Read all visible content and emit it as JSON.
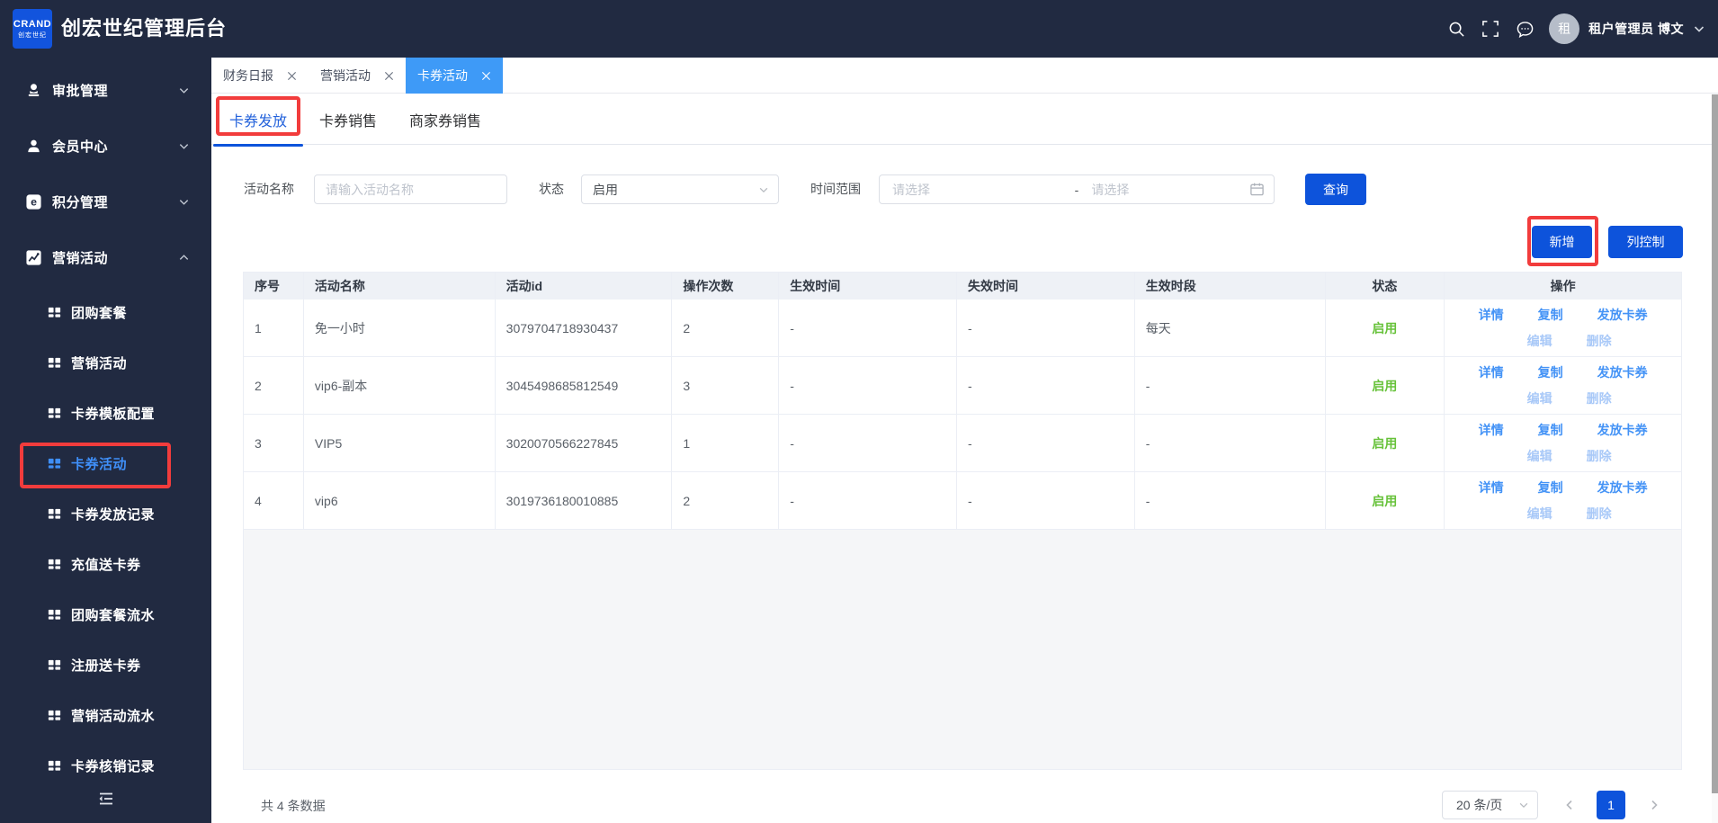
{
  "header": {
    "logo_line1": "CRAND",
    "logo_line2": "创宏世纪",
    "title": "创宏世纪管理后台",
    "user": {
      "avatar_text": "租",
      "name": "租户管理员 博文"
    }
  },
  "sidebar": {
    "menu": [
      {
        "label": "审批管理",
        "icon": "approval-user",
        "expanded": false
      },
      {
        "label": "会员中心",
        "icon": "member-user",
        "expanded": false
      },
      {
        "label": "积分管理",
        "icon": "points",
        "expanded": false
      },
      {
        "label": "营销活动",
        "icon": "marketing-chart",
        "expanded": true
      }
    ],
    "submenu": [
      {
        "label": "团购套餐",
        "active": false
      },
      {
        "label": "营销活动",
        "active": false
      },
      {
        "label": "卡券模板配置",
        "active": false
      },
      {
        "label": "卡券活动",
        "active": true
      },
      {
        "label": "卡券发放记录",
        "active": false
      },
      {
        "label": "充值送卡券",
        "active": false
      },
      {
        "label": "团购套餐流水",
        "active": false
      },
      {
        "label": "注册送卡券",
        "active": false
      },
      {
        "label": "营销活动流水",
        "active": false
      },
      {
        "label": "卡券核销记录",
        "active": false
      }
    ]
  },
  "tabs": [
    {
      "label": "财务日报",
      "active": false
    },
    {
      "label": "营销活动",
      "active": false
    },
    {
      "label": "卡券活动",
      "active": true
    }
  ],
  "subtabs": [
    {
      "label": "卡券发放",
      "active": true
    },
    {
      "label": "卡券销售",
      "active": false
    },
    {
      "label": "商家券销售",
      "active": false
    }
  ],
  "filters": {
    "name_label": "活动名称",
    "name_placeholder": "请输入活动名称",
    "status_label": "状态",
    "status_value": "启用",
    "range_label": "时间范围",
    "range_start_placeholder": "请选择",
    "range_separator": "-",
    "range_end_placeholder": "请选择",
    "search_button": "查询"
  },
  "actions": {
    "add_button": "新增",
    "columns_button": "列控制"
  },
  "table": {
    "headers": [
      "序号",
      "活动名称",
      "活动id",
      "操作次数",
      "生效时间",
      "失效时间",
      "生效时段",
      "状态",
      "操作"
    ],
    "rows": [
      {
        "index": "1",
        "name": "免一小时",
        "id": "3079704718930437",
        "count": "2",
        "start": "-",
        "end": "-",
        "period": "每天",
        "status": "启用"
      },
      {
        "index": "2",
        "name": "vip6-副本",
        "id": "3045498685812549",
        "count": "3",
        "start": "-",
        "end": "-",
        "period": "-",
        "status": "启用"
      },
      {
        "index": "3",
        "name": "VIP5",
        "id": "3020070566227845",
        "count": "1",
        "start": "-",
        "end": "-",
        "period": "-",
        "status": "启用"
      },
      {
        "index": "4",
        "name": "vip6",
        "id": "3019736180010885",
        "count": "2",
        "start": "-",
        "end": "-",
        "period": "-",
        "status": "启用"
      }
    ],
    "ops_row1": [
      "详情",
      "复制",
      "发放卡券"
    ],
    "ops_row2": [
      "编辑",
      "删除"
    ]
  },
  "footer": {
    "total": "共 4 条数据",
    "page_size": "20 条/页",
    "current_page": "1"
  },
  "colors": {
    "navy": "#212a41",
    "primary": "#0d53db",
    "tab_active": "#3e9af7",
    "link_blue": "#4493f6",
    "link_blue_light": "#a9c9f8",
    "success_green": "#67c23a",
    "annotation_red": "#f23c3c"
  }
}
